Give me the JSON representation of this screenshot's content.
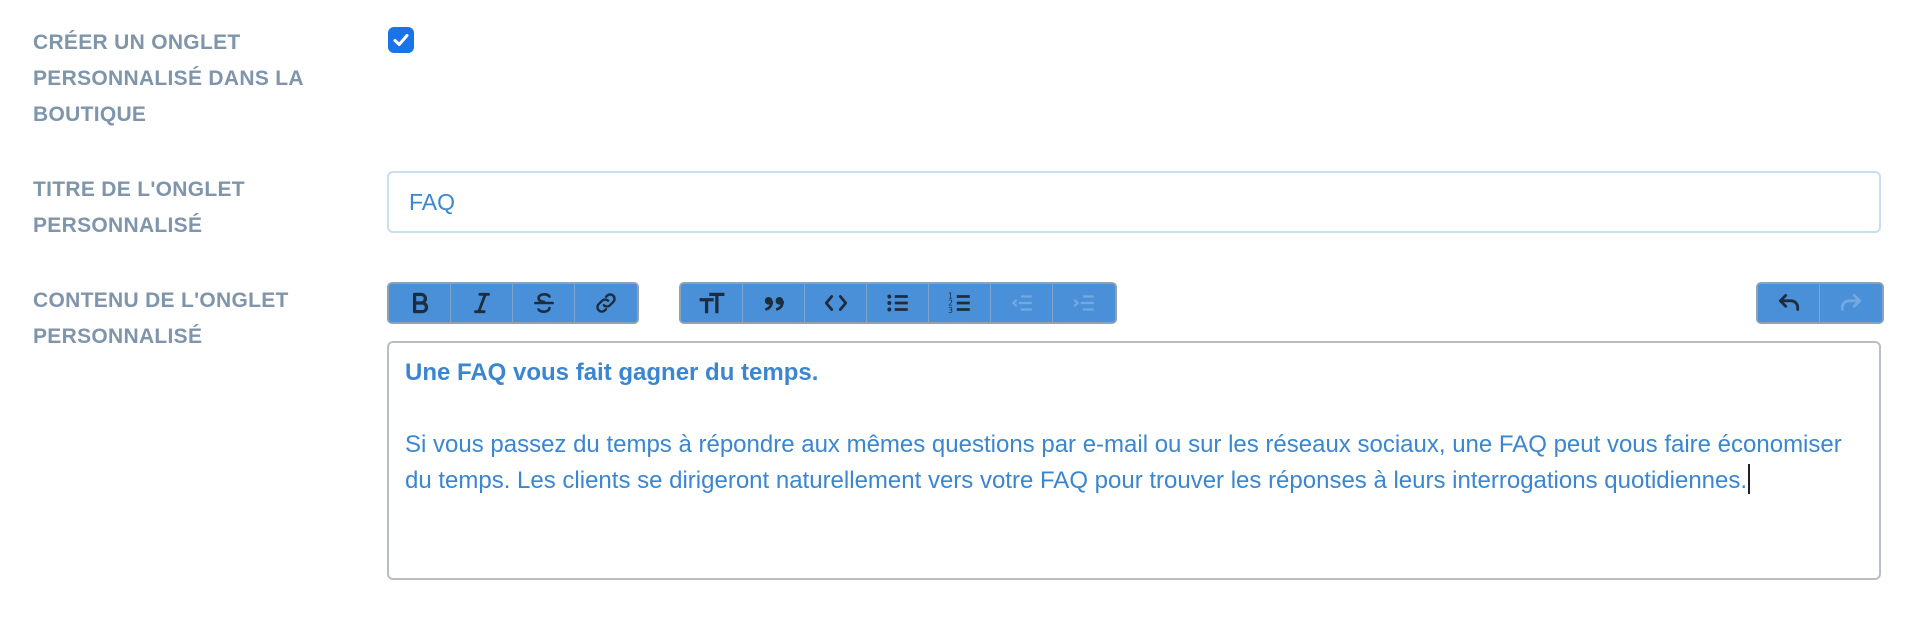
{
  "fields": {
    "create_tab": {
      "label": "CRÉER UN ONGLET\nPERSONNALISÉ DANS LA\nBOUTIQUE",
      "checked": true
    },
    "tab_title": {
      "label": "TITRE DE L'ONGLET\nPERSONNALISÉ",
      "value": "FAQ"
    },
    "tab_content": {
      "label": "CONTENU DE L'ONGLET\nPERSONNALISÉ"
    }
  },
  "toolbar": {
    "group1": [
      "bold-icon",
      "italic-icon",
      "strikethrough-icon",
      "link-icon"
    ],
    "group2": [
      "heading-icon",
      "quote-icon",
      "code-icon",
      "bullet-list-icon",
      "numbered-list-icon",
      "outdent-icon",
      "indent-icon"
    ],
    "group3": [
      "undo-icon",
      "redo-icon"
    ],
    "disabled": [
      "outdent-icon",
      "indent-icon",
      "redo-icon"
    ]
  },
  "editor": {
    "heading": "Une FAQ vous fait gagner du temps.",
    "paragraph": "Si vous passez du temps à répondre aux mêmes questions par e-mail ou sur les réseaux sociaux, une FAQ peut vous faire économiser du temps. Les clients se dirigeront naturellement vers votre FAQ pour trouver les réponses à leurs interrogations quotidiennes."
  },
  "colors": {
    "accent": "#1a73e8",
    "label": "#7f95ab",
    "text": "#3a86d0",
    "toolbar": "#4a90d9"
  }
}
